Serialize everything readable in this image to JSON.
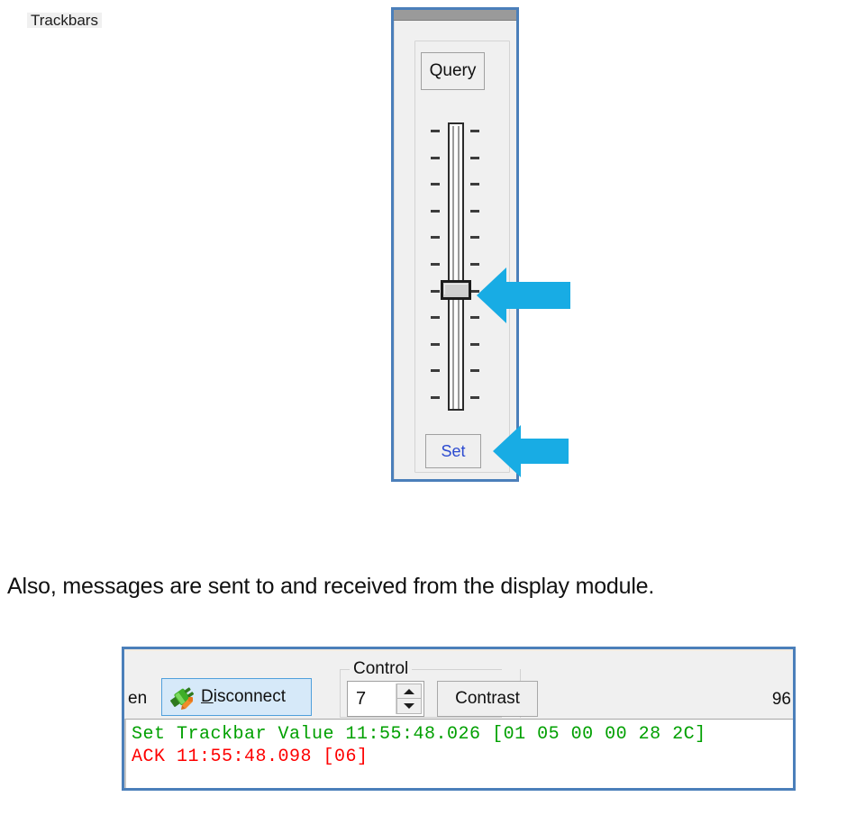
{
  "trackbar_window": {
    "groupbox_label": "Trackbars",
    "query_button": "Query",
    "set_button": "Set",
    "slider": {
      "tick_count": 11,
      "thumb_tick_index": 6,
      "min": 0,
      "max": 10,
      "value": 4,
      "orientation": "vertical"
    }
  },
  "arrows": {
    "color": "#18ace4",
    "slider_arrow_name": "annotation-arrow-slider",
    "set_arrow_name": "annotation-arrow-set"
  },
  "paragraph": {
    "text": "Also, messages are sent to and received from the display module."
  },
  "bottom_panel": {
    "open_partial_label": "en",
    "disconnect_button": {
      "label_prefix": "",
      "accel_letter": "D",
      "label_rest": "isconnect",
      "icon": "plug-disconnect-icon"
    },
    "control_group": {
      "label": "Control",
      "numeric_value": "7",
      "contrast_button": "Contrast"
    },
    "status_number": "96",
    "log": {
      "lines": [
        {
          "text": "Set Trackbar Value 11:55:48.026 [01 05 00 00 28 2C]",
          "color": "#00a000"
        },
        {
          "text": "ACK 11:55:48.098 [06]",
          "color": "#fe0000"
        }
      ]
    }
  },
  "colors": {
    "window_border": "#4b7fba",
    "arrow_blue": "#18ace4",
    "log_sent": "#00a000",
    "log_ack": "#fe0000",
    "set_button_text": "#2b4ad0"
  }
}
